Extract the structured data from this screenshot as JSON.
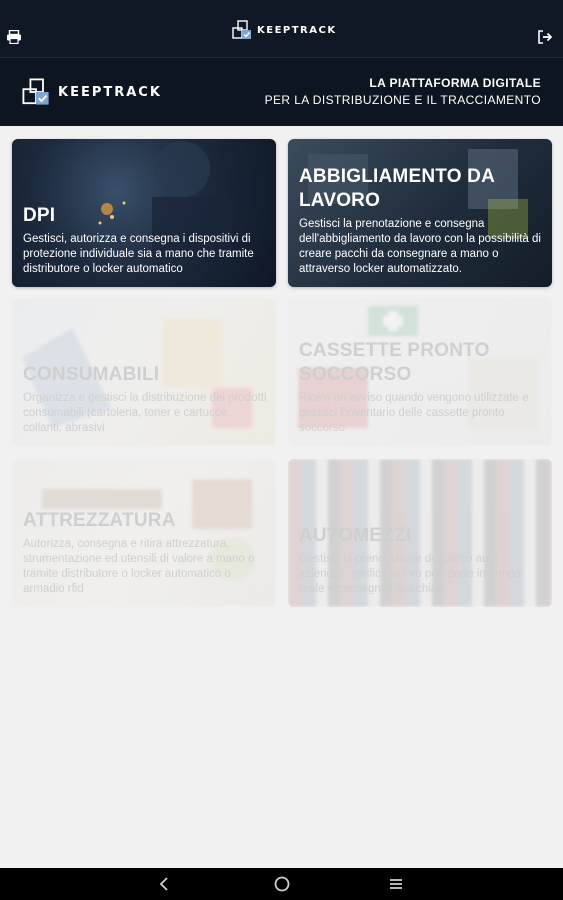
{
  "topbar": {
    "brand": "KEEPTRACK",
    "print_icon": "print-icon",
    "logout_icon": "logout-icon"
  },
  "hero": {
    "brand": "KEEPTRACK",
    "tagline_line1": "LA PIATTAFORMA DIGITALE",
    "tagline_line2": "PER LA DISTRIBUZIONE E IL TRACCIAMENTO"
  },
  "cards": [
    {
      "title": "DPI",
      "description": "Gestisci, autorizza e consegna i dispositivi di protezione individuale sia a mano che tramite distributore o locker automatico",
      "enabled": true
    },
    {
      "title": "ABBIGLIAMENTO DA LAVORO",
      "description": "Gestisci la prenotazione e consegna dell'abbigliamento da lavoro con la possibilità di creare pacchi da consegnare a mano o attraverso locker automatizzato.",
      "enabled": true
    },
    {
      "title": "CONSUMABILI",
      "description": "Organizza e gestisci la distribuzione dei prodotti consumabili (cartoleria, toner e cartucce, collanti, abrasivi",
      "enabled": false
    },
    {
      "title": "CASSETTE PRONTO SOCCORSO",
      "description": "Ricevi un avviso quando vengono utilizzate e gestisci l'inventario delle cassette pronto soccorso",
      "enabled": false
    },
    {
      "title": "ATTREZZATURA",
      "description": "Autorizza, consegna e ritira attrezzatura, strumentazione ed utensili di valore a mano o tramite distributore o locker automatico o armadio rfid",
      "enabled": false
    },
    {
      "title": "AUTOMEZZI",
      "description": "Gestisci la prenotazione del parco auto aziendali, verifica la loro posizione in tempo reale e consegna/ritira chiavi",
      "enabled": false
    }
  ],
  "navbar": {
    "back_icon": "back-icon",
    "home_icon": "home-icon",
    "recents_icon": "recents-icon"
  },
  "colors": {
    "header_bg": "#0f1824",
    "hero_bg": "#0d1521",
    "page_bg": "#f1f1f1",
    "logo_accent": "#7fa6d1"
  }
}
